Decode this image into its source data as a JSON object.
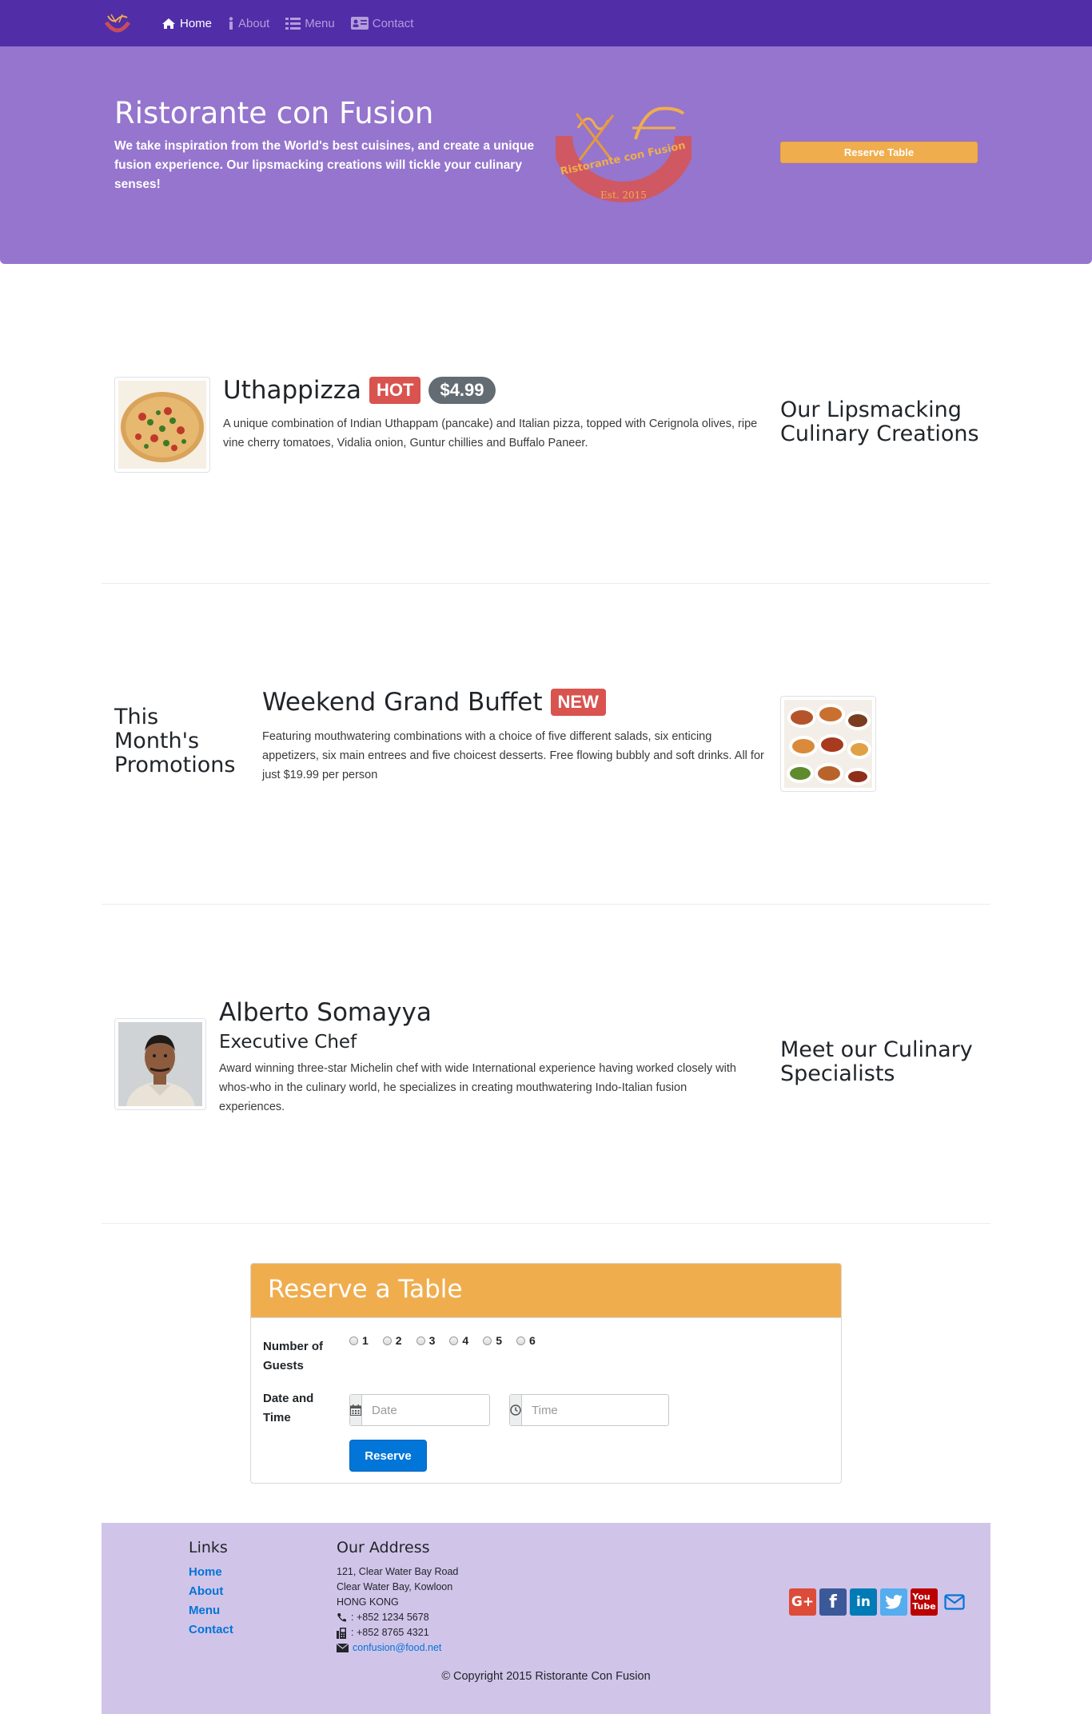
{
  "nav": {
    "items": [
      {
        "label": "Home",
        "icon": "home-icon",
        "active": true
      },
      {
        "label": "About",
        "icon": "info-icon",
        "active": false
      },
      {
        "label": "Menu",
        "icon": "list-icon",
        "active": false
      },
      {
        "label": "Contact",
        "icon": "address-card-icon",
        "active": false
      }
    ]
  },
  "jumbotron": {
    "title": "Ristorante con Fusion",
    "text": "We take inspiration from the World's best cuisines, and create a unique fusion experience. Our lipsmacking creations will tickle your culinary senses!",
    "logo_text": "Ristorante con Fusion",
    "logo_est": "Est. 2015",
    "reserve_button": "Reserve Table"
  },
  "dish": {
    "name": "Uthappizza",
    "badge": "HOT",
    "price": "$4.99",
    "description": "A unique combination of Indian Uthappam (pancake) and Italian pizza, topped with Cerignola olives, ripe vine cherry tomatoes, Vidalia onion, Guntur chillies and Buffalo Paneer.",
    "side_heading": "Our Lipsmacking Culinary Creations"
  },
  "promotion": {
    "side_heading": "This Month's Promotions",
    "name": "Weekend Grand Buffet",
    "badge": "NEW",
    "description": "Featuring mouthwatering combinations with a choice of five different salads, six enticing appetizers, six main entrees and five choicest desserts. Free flowing bubbly and soft drinks. All for just $19.99 per person"
  },
  "leader": {
    "name": "Alberto Somayya",
    "designation": "Executive Chef",
    "description": "Award winning three-star Michelin chef with wide International experience having worked closely with whos-who in the culinary world, he specializes in creating mouthwatering Indo-Italian fusion experiences.",
    "side_heading": "Meet our Culinary Specialists"
  },
  "reserve": {
    "title": "Reserve a Table",
    "guests_label": "Number of Guests",
    "guest_options": [
      "1",
      "2",
      "3",
      "4",
      "5",
      "6"
    ],
    "datetime_label": "Date and Time",
    "date_placeholder": "Date",
    "time_placeholder": "Time",
    "submit_label": "Reserve"
  },
  "footer": {
    "links_heading": "Links",
    "links": [
      "Home",
      "About",
      "Menu",
      "Contact"
    ],
    "address_heading": "Our Address",
    "address_lines": [
      "121, Clear Water Bay Road",
      "Clear Water Bay, Kowloon",
      "HONG KONG"
    ],
    "phone": ": +852 1234 5678",
    "fax": ": +852 8765 4321",
    "email": "confusion@food.net",
    "socials": [
      "google-plus-icon",
      "facebook-icon",
      "linkedin-icon",
      "twitter-icon",
      "youtube-icon",
      "envelope-icon"
    ],
    "copyright": "© Copyright 2015 Ristorante Con Fusion"
  },
  "colors": {
    "navbar": "#512da8",
    "jumbotron": "#9575cd",
    "footer": "#d1c4e9",
    "warning": "#f0ad4e",
    "primary": "#0275d8",
    "danger": "#d9534f"
  }
}
